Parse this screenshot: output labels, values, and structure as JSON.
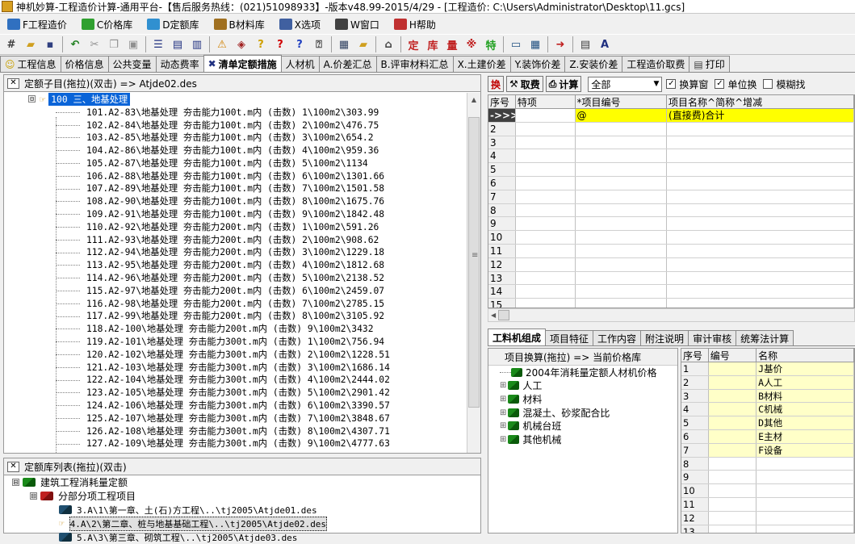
{
  "title_text": "神机妙算-工程造价计算-通用平台-【售后服务热线：(021)51098933】-版本v48.99-2015/4/29 - [工程造价: C:\\Users\\Administrator\\Desktop\\11.gcs]",
  "menu": [
    {
      "label": "F工程造价",
      "icon": "tool-icon",
      "color": "#3070c0"
    },
    {
      "label": "C价格库",
      "icon": "cube-icon",
      "color": "#30a030"
    },
    {
      "label": "D定额库",
      "icon": "cube-icon",
      "color": "#3090d0"
    },
    {
      "label": "B材料库",
      "icon": "books-icon",
      "color": "#a07020"
    },
    {
      "label": "X选项",
      "icon": "options-icon",
      "color": "#4060a0"
    },
    {
      "label": "W窗口",
      "icon": "window-icon",
      "color": "#404040"
    },
    {
      "label": "H帮助",
      "icon": "help-icon",
      "color": "#c03030"
    }
  ],
  "toolbar": {
    "buttons": [
      {
        "name": "calculator-icon",
        "glyph": "#",
        "color": "#404040"
      },
      {
        "name": "open-icon",
        "glyph": "▰",
        "color": "#d0a020"
      },
      {
        "name": "save-icon",
        "glyph": "▪",
        "color": "#304080"
      },
      {
        "sep": true
      },
      {
        "name": "undo-icon",
        "glyph": "↶",
        "color": "#208020"
      },
      {
        "name": "cut-icon",
        "glyph": "✂",
        "color": "#909090"
      },
      {
        "name": "copy-icon",
        "glyph": "❐",
        "color": "#909090"
      },
      {
        "name": "paste-icon",
        "glyph": "▣",
        "color": "#909090"
      },
      {
        "sep": true
      },
      {
        "name": "insert-row-icon",
        "glyph": "☰",
        "color": "#203080"
      },
      {
        "name": "delete-row-icon",
        "glyph": "▤",
        "color": "#203080"
      },
      {
        "name": "columns-icon",
        "glyph": "▥",
        "color": "#203080"
      },
      {
        "sep": true
      },
      {
        "name": "warning-icon",
        "glyph": "⚠",
        "color": "#d08000"
      },
      {
        "name": "tag-icon",
        "glyph": "◈",
        "color": "#a02020"
      },
      {
        "name": "query-icon",
        "glyph": "?",
        "color": "#d0a000"
      },
      {
        "name": "help-red-icon",
        "glyph": "?",
        "color": "#d00000"
      },
      {
        "name": "help-blue-icon",
        "glyph": "?",
        "color": "#2040c0"
      },
      {
        "name": "help-box-icon",
        "glyph": "⍰",
        "color": "#404040"
      },
      {
        "sep": true
      },
      {
        "name": "report-icon",
        "glyph": "▦",
        "color": "#304060"
      },
      {
        "name": "folder-icon",
        "glyph": "▰",
        "color": "#d0a020"
      },
      {
        "sep": true
      },
      {
        "name": "home-icon",
        "glyph": "⌂",
        "color": "#404040"
      },
      {
        "sep": true
      },
      {
        "name": "ding-icon",
        "glyph": "定",
        "color": "#c02020"
      },
      {
        "name": "ku-icon",
        "glyph": "库",
        "color": "#c02020"
      },
      {
        "name": "liang-icon",
        "glyph": "量",
        "color": "#c02020"
      },
      {
        "name": "change-icon",
        "glyph": "※",
        "color": "#c02020"
      },
      {
        "name": "te-icon",
        "glyph": "特",
        "color": "#20a020"
      },
      {
        "sep": true
      },
      {
        "name": "monitor-icon",
        "glyph": "▭",
        "color": "#205080"
      },
      {
        "name": "calc-grid-icon",
        "glyph": "▦",
        "color": "#205080"
      },
      {
        "sep": true
      },
      {
        "name": "exit-icon",
        "glyph": "➜",
        "color": "#c02020"
      },
      {
        "sep": true
      },
      {
        "name": "print-icon",
        "glyph": "▤",
        "color": "#404040"
      },
      {
        "name": "font-a-icon",
        "glyph": "A",
        "color": "#203080"
      }
    ]
  },
  "tabs": [
    {
      "label": "工程信息",
      "icon": "☺",
      "icon_color": "#c8a000"
    },
    {
      "label": "价格信息"
    },
    {
      "label": "公共变量"
    },
    {
      "label": "动态费率"
    },
    {
      "label": "清单定额措施",
      "icon": "✖",
      "icon_color": "#203080",
      "active": true
    },
    {
      "label": "人材机"
    },
    {
      "label": "A.价差汇总"
    },
    {
      "label": "B.评审材料汇总"
    },
    {
      "label": "X.土建价差"
    },
    {
      "label": "Y.装饰价差"
    },
    {
      "label": "Z.安装价差"
    },
    {
      "label": "工程造价取费"
    },
    {
      "label": "打印",
      "icon": "▤",
      "icon_color": "#404040"
    }
  ],
  "left_top": {
    "header": "定额子目(拖拉)(双击) => Atjde02.des",
    "root_expander": "⊟",
    "root_label": "100 三、地基处理",
    "items": [
      "101.A2-83\\地基处理 夯击能力100t.m内 (击数) 1\\100m2\\303.99",
      "102.A2-84\\地基处理 夯击能力100t.m内 (击数) 2\\100m2\\476.75",
      "103.A2-85\\地基处理 夯击能力100t.m内 (击数) 3\\100m2\\654.2",
      "104.A2-86\\地基处理 夯击能力100t.m内 (击数) 4\\100m2\\959.36",
      "105.A2-87\\地基处理 夯击能力100t.m内 (击数) 5\\100m2\\1134",
      "106.A2-88\\地基处理 夯击能力100t.m内 (击数) 6\\100m2\\1301.66",
      "107.A2-89\\地基处理 夯击能力100t.m内 (击数) 7\\100m2\\1501.58",
      "108.A2-90\\地基处理 夯击能力100t.m内 (击数) 8\\100m2\\1675.76",
      "109.A2-91\\地基处理 夯击能力100t.m内 (击数) 9\\100m2\\1842.48",
      "110.A2-92\\地基处理 夯击能力200t.m内 (击数) 1\\100m2\\591.26",
      "111.A2-93\\地基处理 夯击能力200t.m内 (击数) 2\\100m2\\908.62",
      "112.A2-94\\地基处理 夯击能力200t.m内 (击数) 3\\100m2\\1229.18",
      "113.A2-95\\地基处理 夯击能力200t.m内 (击数) 4\\100m2\\1812.68",
      "114.A2-96\\地基处理 夯击能力200t.m内 (击数) 5\\100m2\\2138.52",
      "115.A2-97\\地基处理 夯击能力200t.m内 (击数) 6\\100m2\\2459.07",
      "116.A2-98\\地基处理 夯击能力200t.m内 (击数) 7\\100m2\\2785.15",
      "117.A2-99\\地基处理 夯击能力200t.m内 (击数) 8\\100m2\\3105.92",
      "118.A2-100\\地基处理 夯击能力200t.m内 (击数) 9\\100m2\\3432",
      "119.A2-101\\地基处理 夯击能力300t.m内 (击数) 1\\100m2\\756.94",
      "120.A2-102\\地基处理 夯击能力300t.m内 (击数) 2\\100m2\\1228.51",
      "121.A2-103\\地基处理 夯击能力300t.m内 (击数) 3\\100m2\\1686.14",
      "122.A2-104\\地基处理 夯击能力300t.m内 (击数) 4\\100m2\\2444.02",
      "123.A2-105\\地基处理 夯击能力300t.m内 (击数) 5\\100m2\\2901.42",
      "124.A2-106\\地基处理 夯击能力300t.m内 (击数) 6\\100m2\\3390.57",
      "125.A2-107\\地基处理 夯击能力300t.m内 (击数) 7\\100m2\\3848.67",
      "126.A2-108\\地基处理 夯击能力300t.m内 (击数) 8\\100m2\\4307.71",
      "127.A2-109\\地基处理 夯击能力300t.m内 (击数) 9\\100m2\\4777.63"
    ]
  },
  "left_bottom": {
    "header": "定额库列表(拖拉)(双击)",
    "nodes": [
      {
        "label": "建筑工程消耗量定额",
        "expander": "⊟",
        "book": "green",
        "indent": 0
      },
      {
        "label": "分部分项工程项目",
        "expander": "⊟",
        "book": "red",
        "indent": 1
      },
      {
        "label": "3.A\\1\\第一章、土(石)方工程\\..\\tj2005\\Atjde01.des",
        "book": "dark",
        "indent": 2
      },
      {
        "label": "4.A\\2\\第二章、桩与地基基础工程\\..\\tj2005\\Atjde02.des",
        "book": "hand",
        "indent": 2,
        "selected": true
      },
      {
        "label": "5.A\\3\\第三章、砌筑工程\\..\\tj2005\\Atjde03.des",
        "book": "dark",
        "indent": 2
      }
    ]
  },
  "right_toolbar": {
    "swap_label": "换",
    "fee_label": "取费",
    "calc_label": "计算",
    "filter_value": "全部",
    "checkboxes": [
      {
        "label": "换算窗",
        "checked": true
      },
      {
        "label": "单位换",
        "checked": true
      },
      {
        "label": "模糊找",
        "checked": false
      }
    ]
  },
  "grid1": {
    "headers": [
      "序号",
      "特项",
      "*项目编号",
      "项目名称^简称^增减"
    ],
    "first_row": {
      "marker": "->>>",
      "tx": "",
      "code": "@",
      "name": "(直接费)合计"
    },
    "row_numbers": [
      "2",
      "3",
      "4",
      "5",
      "6",
      "7",
      "8",
      "9",
      "10",
      "11",
      "12",
      "13",
      "14",
      "15"
    ]
  },
  "right_tabs": [
    {
      "label": "工料机组成",
      "active": true
    },
    {
      "label": "项目特征"
    },
    {
      "label": "工作内容"
    },
    {
      "label": "附注说明"
    },
    {
      "label": "审计审核"
    },
    {
      "label": "统筹法计算"
    }
  ],
  "price_tree": {
    "header": "项目换算(拖拉) => 当前价格库",
    "nodes": [
      {
        "label": "2004年消耗量定额人材机价格",
        "expander": ""
      },
      {
        "label": "人工",
        "expander": "⊞"
      },
      {
        "label": "材料",
        "expander": "⊞"
      },
      {
        "label": "混凝土、砂浆配合比",
        "expander": "⊞"
      },
      {
        "label": "机械台班",
        "expander": "⊞"
      },
      {
        "label": "其他机械",
        "expander": "⊞"
      }
    ]
  },
  "grid2": {
    "headers": [
      "序号",
      "编号",
      "名称"
    ],
    "rows": [
      {
        "num": "1",
        "name": "J基价"
      },
      {
        "num": "2",
        "name": "A人工"
      },
      {
        "num": "3",
        "name": "B材料"
      },
      {
        "num": "4",
        "name": "C机械"
      },
      {
        "num": "5",
        "name": "D其他"
      },
      {
        "num": "6",
        "name": "E主材"
      },
      {
        "num": "7",
        "name": "F设备"
      },
      {
        "num": "8",
        "name": ""
      },
      {
        "num": "9",
        "name": ""
      },
      {
        "num": "10",
        "name": ""
      },
      {
        "num": "11",
        "name": ""
      },
      {
        "num": "12",
        "name": ""
      },
      {
        "num": "13",
        "name": ""
      }
    ]
  }
}
